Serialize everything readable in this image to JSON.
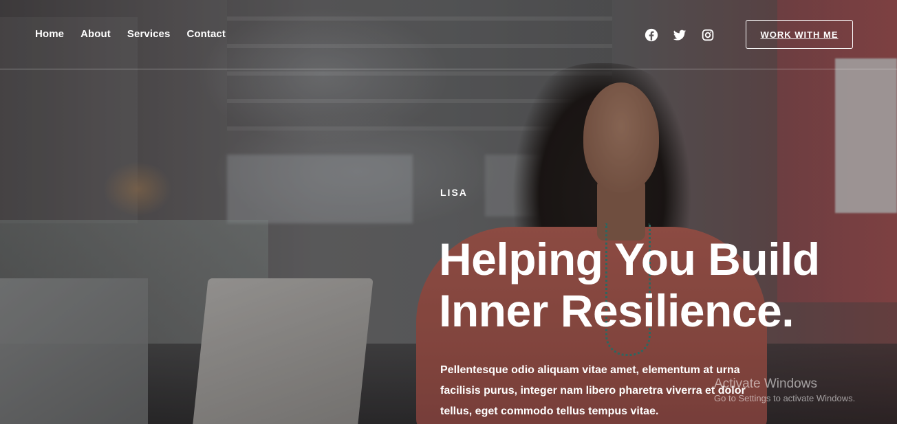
{
  "nav": {
    "items": [
      {
        "label": "Home"
      },
      {
        "label": "About"
      },
      {
        "label": "Services"
      },
      {
        "label": "Contact"
      }
    ]
  },
  "social": {
    "icons": [
      "facebook-icon",
      "twitter-icon",
      "instagram-icon"
    ]
  },
  "cta": {
    "label": "WORK WITH ME"
  },
  "hero": {
    "eyebrow": "LISA",
    "headline_line1": "Helping You Build",
    "headline_line2": "Inner Resilience.",
    "lede_line1": "Pellentesque odio aliquam vitae amet, elementum at urna",
    "lede_line2": "facilisis purus, integer nam libero pharetra viverra et dolor",
    "lede_line3": "tellus, eget commodo tellus tempus vitae."
  },
  "watermark": {
    "title": "Activate Windows",
    "subtitle": "Go to Settings to activate Windows."
  },
  "colors": {
    "text": "#ffffff",
    "overlay": "#000000",
    "divider": "#ffffff"
  }
}
